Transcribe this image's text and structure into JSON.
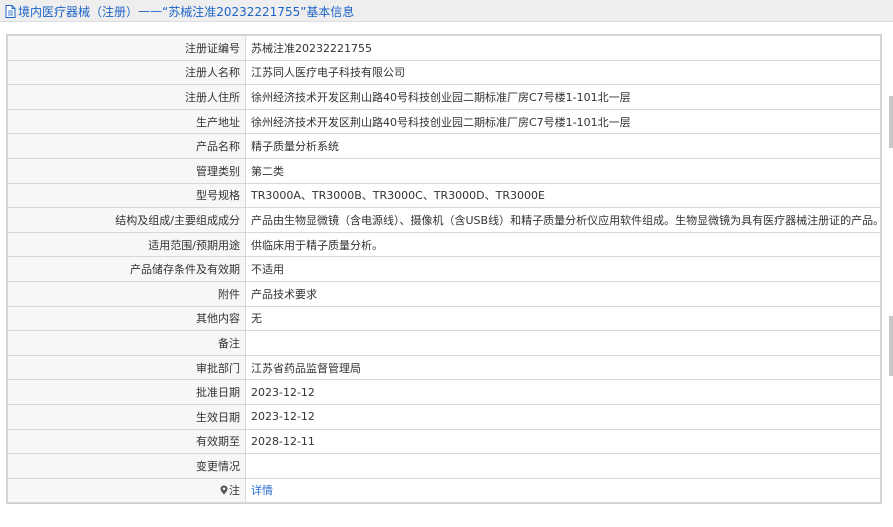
{
  "header": {
    "category": "境内医疗器械（注册）",
    "separator": " —— ",
    "title": "“苏械注准20232221755”基本信息"
  },
  "rows": [
    {
      "label": "注册证编号",
      "value": "苏械注准20232221755"
    },
    {
      "label": "注册人名称",
      "value": "江苏同人医疗电子科技有限公司"
    },
    {
      "label": "注册人住所",
      "value": "徐州经济技术开发区荆山路40号科技创业园二期标准厂房C7号楼1-101北一层"
    },
    {
      "label": "生产地址",
      "value": "徐州经济技术开发区荆山路40号科技创业园二期标准厂房C7号楼1-101北一层"
    },
    {
      "label": "产品名称",
      "value": "精子质量分析系统"
    },
    {
      "label": "管理类别",
      "value": "第二类"
    },
    {
      "label": "型号规格",
      "value": "TR3000A、TR3000B、TR3000C、TR3000D、TR3000E"
    },
    {
      "label": "结构及组成/主要组成成分",
      "value": "产品由生物显微镜（含电源线）、摄像机（含USB线）和精子质量分析仪应用软件组成。生物显微镜为具有医疗器械注册证的产品。"
    },
    {
      "label": "适用范围/预期用途",
      "value": "供临床用于精子质量分析。"
    },
    {
      "label": "产品储存条件及有效期",
      "value": "不适用"
    },
    {
      "label": "附件",
      "value": "产品技术要求"
    },
    {
      "label": "其他内容",
      "value": "无"
    },
    {
      "label": "备注",
      "value": ""
    },
    {
      "label": "审批部门",
      "value": "江苏省药品监督管理局"
    },
    {
      "label": "批准日期",
      "value": "2023-12-12"
    },
    {
      "label": "生效日期",
      "value": "2023-12-12"
    },
    {
      "label": "有效期至",
      "value": "2028-12-11"
    },
    {
      "label": "变更情况",
      "value": ""
    }
  ],
  "note_row": {
    "label": "注",
    "link": "详情"
  },
  "icons": {
    "header": "document-icon",
    "note": "pin-icon"
  },
  "colors": {
    "accent": "#1e64c8",
    "link": "#2a6bd0",
    "header_bg": "#eeeeee",
    "label_bg": "#f7f7f7"
  }
}
